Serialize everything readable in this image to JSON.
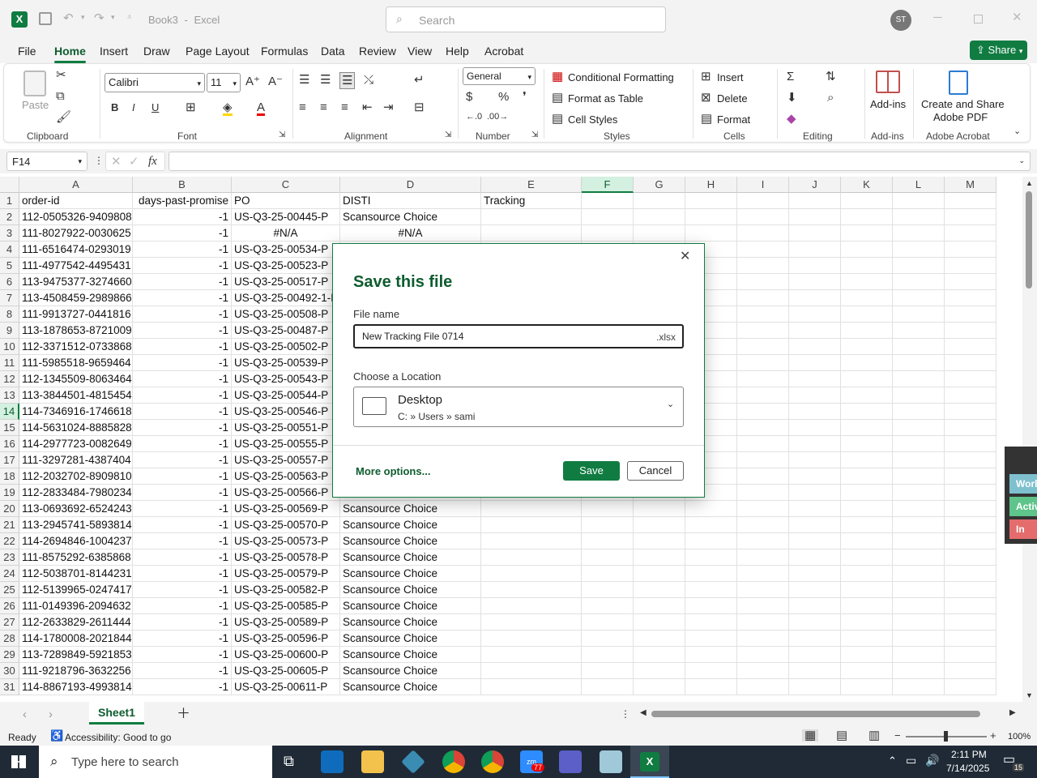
{
  "titlebar": {
    "app_icon": "excel-icon",
    "doc_title": "Book3",
    "app_name": "Excel",
    "separator": "-",
    "search_placeholder": "Search",
    "user_initials": "ST"
  },
  "ribbon_tabs": [
    "File",
    "Home",
    "Insert",
    "Draw",
    "Page Layout",
    "Formulas",
    "Data",
    "Review",
    "View",
    "Help",
    "Acrobat"
  ],
  "share_label": "Share",
  "ribbon": {
    "paste": "Paste",
    "clipboard": "Clipboard",
    "font_name": "Calibri",
    "font_size": "11",
    "font": "Font",
    "alignment": "Alignment",
    "number_format": "General",
    "number": "Number",
    "conditional": "Conditional Formatting",
    "format_table": "Format as Table",
    "cell_styles": "Cell Styles",
    "styles": "Styles",
    "insert": "Insert",
    "delete": "Delete",
    "format": "Format",
    "cells": "Cells",
    "editing": "Editing",
    "addins_btn": "Add-ins",
    "addins": "Add-ins",
    "create_share": "Create and Share",
    "adobe_pdf": "Adobe PDF",
    "adobe_acrobat": "Adobe Acrobat",
    "bold": "B",
    "italic": "I",
    "underline": "U"
  },
  "formula_bar": {
    "name_box": "F14",
    "fx": "fx",
    "value": ""
  },
  "columns": [
    "A",
    "B",
    "C",
    "D",
    "E",
    "F",
    "G",
    "H",
    "I",
    "J",
    "K",
    "L",
    "M"
  ],
  "selected_col": "F",
  "selected_row": 14,
  "rows": [
    {
      "n": "1",
      "a": "order-id",
      "b": "days-past-promise",
      "c": "PO",
      "d": "DISTI",
      "e": "Tracking"
    },
    {
      "n": "2",
      "a": "112-0505326-9409808",
      "b": "-1",
      "c": "US-Q3-25-00445-P",
      "d": "Scansource Choice"
    },
    {
      "n": "3",
      "a": "111-8027922-0030625",
      "b": "-1",
      "c": "#N/A",
      "d": "#N/A"
    },
    {
      "n": "4",
      "a": "111-6516474-0293019",
      "b": "-1",
      "c": "US-Q3-25-00534-P",
      "d": ""
    },
    {
      "n": "5",
      "a": "111-4977542-4495431",
      "b": "-1",
      "c": "US-Q3-25-00523-P",
      "d": ""
    },
    {
      "n": "6",
      "a": "113-9475377-3274660",
      "b": "-1",
      "c": "US-Q3-25-00517-P",
      "d": ""
    },
    {
      "n": "7",
      "a": "113-4508459-2989866",
      "b": "-1",
      "c": "US-Q3-25-00492-1-P",
      "d": ""
    },
    {
      "n": "8",
      "a": "111-9913727-0441816",
      "b": "-1",
      "c": "US-Q3-25-00508-P",
      "d": ""
    },
    {
      "n": "9",
      "a": "113-1878653-8721009",
      "b": "-1",
      "c": "US-Q3-25-00487-P",
      "d": ""
    },
    {
      "n": "10",
      "a": "112-3371512-0733868",
      "b": "-1",
      "c": "US-Q3-25-00502-P",
      "d": ""
    },
    {
      "n": "11",
      "a": "111-5985518-9659464",
      "b": "-1",
      "c": "US-Q3-25-00539-P",
      "d": ""
    },
    {
      "n": "12",
      "a": "112-1345509-8063464",
      "b": "-1",
      "c": "US-Q3-25-00543-P",
      "d": ""
    },
    {
      "n": "13",
      "a": "113-3844501-4815454",
      "b": "-1",
      "c": "US-Q3-25-00544-P",
      "d": ""
    },
    {
      "n": "14",
      "a": "114-7346916-1746618",
      "b": "-1",
      "c": "US-Q3-25-00546-P",
      "d": ""
    },
    {
      "n": "15",
      "a": "114-5631024-8885828",
      "b": "-1",
      "c": "US-Q3-25-00551-P",
      "d": ""
    },
    {
      "n": "16",
      "a": "114-2977723-0082649",
      "b": "-1",
      "c": "US-Q3-25-00555-P",
      "d": ""
    },
    {
      "n": "17",
      "a": "111-3297281-4387404",
      "b": "-1",
      "c": "US-Q3-25-00557-P",
      "d": ""
    },
    {
      "n": "18",
      "a": "112-2032702-8909810",
      "b": "-1",
      "c": "US-Q3-25-00563-P",
      "d": ""
    },
    {
      "n": "19",
      "a": "112-2833484-7980234",
      "b": "-1",
      "c": "US-Q3-25-00566-P",
      "d": ""
    },
    {
      "n": "20",
      "a": "113-0693692-6524243",
      "b": "-1",
      "c": "US-Q3-25-00569-P",
      "d": "Scansource Choice"
    },
    {
      "n": "21",
      "a": "113-2945741-5893814",
      "b": "-1",
      "c": "US-Q3-25-00570-P",
      "d": "Scansource Choice"
    },
    {
      "n": "22",
      "a": "114-2694846-1004237",
      "b": "-1",
      "c": "US-Q3-25-00573-P",
      "d": "Scansource Choice"
    },
    {
      "n": "23",
      "a": "111-8575292-6385868",
      "b": "-1",
      "c": "US-Q3-25-00578-P",
      "d": "Scansource Choice"
    },
    {
      "n": "24",
      "a": "112-5038701-8144231",
      "b": "-1",
      "c": "US-Q3-25-00579-P",
      "d": "Scansource Choice"
    },
    {
      "n": "25",
      "a": "112-5139965-0247417",
      "b": "-1",
      "c": "US-Q3-25-00582-P",
      "d": "Scansource Choice"
    },
    {
      "n": "26",
      "a": "111-0149396-2094632",
      "b": "-1",
      "c": "US-Q3-25-00585-P",
      "d": "Scansource Choice"
    },
    {
      "n": "27",
      "a": "112-2633829-2611444",
      "b": "-1",
      "c": "US-Q3-25-00589-P",
      "d": "Scansource Choice"
    },
    {
      "n": "28",
      "a": "114-1780008-2021844",
      "b": "-1",
      "c": "US-Q3-25-00596-P",
      "d": "Scansource Choice"
    },
    {
      "n": "29",
      "a": "113-7289849-5921853",
      "b": "-1",
      "c": "US-Q3-25-00600-P",
      "d": "Scansource Choice"
    },
    {
      "n": "30",
      "a": "111-9218796-3632256",
      "b": "-1",
      "c": "US-Q3-25-00605-P",
      "d": "Scansource Choice"
    },
    {
      "n": "31",
      "a": "114-8867193-4993814",
      "b": "-1",
      "c": "US-Q3-25-00611-P",
      "d": "Scansource Choice"
    }
  ],
  "dialog": {
    "title": "Save this file",
    "file_name_label": "File name",
    "file_name_value": "New Tracking File 0714",
    "extension": ".xlsx",
    "location_label": "Choose a Location",
    "location_name": "Desktop",
    "location_path": "C: » Users » sami",
    "more_options": "More options...",
    "save": "Save",
    "cancel": "Cancel"
  },
  "side_panel": {
    "item1": "Worl",
    "item2": "Activ",
    "item3": "In Ac"
  },
  "sheet_tab": "Sheet1",
  "status": {
    "ready": "Ready",
    "accessibility": "Accessibility: Good to go",
    "zoom": "100%"
  },
  "taskbar": {
    "search_placeholder": "Type here to search",
    "time": "2:11 PM",
    "date": "7/14/2025",
    "notif_count": "15",
    "zoom_badge": "77"
  },
  "colors": {
    "excel_green": "#107c41",
    "accent_dark": "#0e5c2f",
    "taskbar": "#1f2a36"
  }
}
